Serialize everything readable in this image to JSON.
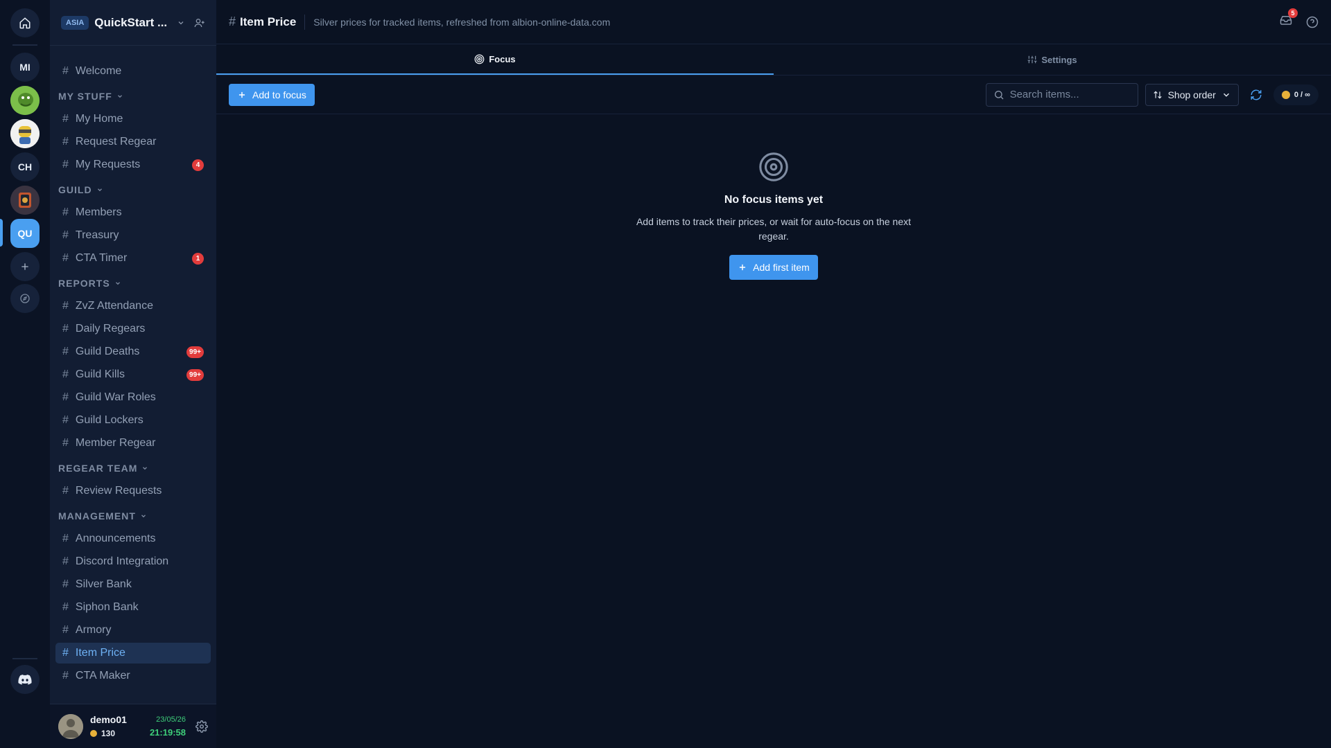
{
  "rail": {
    "items": [
      {
        "label": "MI"
      },
      {
        "label": "CH"
      },
      {
        "label": "QU"
      }
    ]
  },
  "guild": {
    "region": "ASIA",
    "name": "QuickStart ..."
  },
  "channels": {
    "welcome": "Welcome",
    "categories": [
      {
        "title": "MY STUFF",
        "items": [
          {
            "label": "My Home"
          },
          {
            "label": "Request Regear"
          },
          {
            "label": "My Requests",
            "badge": "4"
          }
        ]
      },
      {
        "title": "GUILD",
        "items": [
          {
            "label": "Members"
          },
          {
            "label": "Treasury"
          },
          {
            "label": "CTA Timer",
            "badge": "1"
          }
        ]
      },
      {
        "title": "REPORTS",
        "items": [
          {
            "label": "ZvZ Attendance"
          },
          {
            "label": "Daily Regears"
          },
          {
            "label": "Guild Deaths",
            "badge": "99+"
          },
          {
            "label": "Guild Kills",
            "badge": "99+"
          },
          {
            "label": "Guild War Roles"
          },
          {
            "label": "Guild Lockers"
          },
          {
            "label": "Member Regear"
          }
        ]
      },
      {
        "title": "REGEAR TEAM",
        "items": [
          {
            "label": "Review Requests"
          }
        ]
      },
      {
        "title": "MANAGEMENT",
        "items": [
          {
            "label": "Announcements"
          },
          {
            "label": "Discord Integration"
          },
          {
            "label": "Silver Bank"
          },
          {
            "label": "Siphon Bank"
          },
          {
            "label": "Armory"
          },
          {
            "label": "Item Price",
            "active": true
          },
          {
            "label": "CTA Maker"
          }
        ]
      }
    ]
  },
  "user": {
    "name": "demo01",
    "coins": "130",
    "date": "23/05/26",
    "time": "21:19:58"
  },
  "header": {
    "title": "Item Price",
    "subtitle": "Silver prices for tracked items, refreshed from albion-online-data.com",
    "inbox_badge": "5"
  },
  "tabs": [
    {
      "label": "Focus",
      "active": true
    },
    {
      "label": "Settings"
    }
  ],
  "toolbar": {
    "add_label": "Add to focus",
    "search_placeholder": "Search items...",
    "sort_label": "Shop order",
    "quota": "0 / ∞"
  },
  "empty": {
    "title": "No focus items yet",
    "description": "Add items to track their prices, or wait for auto-focus on the next regear.",
    "button": "Add first item"
  },
  "colors": {
    "accent": "#4a9ff0",
    "badge": "#e23c3c",
    "clock": "#3ecf7a"
  }
}
